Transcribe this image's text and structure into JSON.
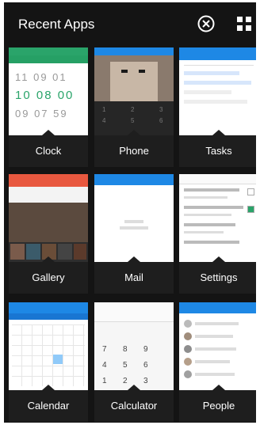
{
  "header": {
    "title": "Recent Apps"
  },
  "icons": {
    "close": "close-circle-icon",
    "grid": "grid-view-icon"
  },
  "apps": [
    {
      "label": "Clock"
    },
    {
      "label": "Phone"
    },
    {
      "label": "Tasks"
    },
    {
      "label": "Gallery"
    },
    {
      "label": "Mail"
    },
    {
      "label": "Settings"
    },
    {
      "label": "Calendar"
    },
    {
      "label": "Calculator"
    },
    {
      "label": "People"
    }
  ],
  "clock": {
    "times": [
      "11 09 01",
      "10 08 00",
      "09 07 59"
    ]
  },
  "calculator": {
    "keys": [
      "7",
      "8",
      "9",
      "4",
      "5",
      "6",
      "1",
      "2",
      "3"
    ]
  },
  "colors": {
    "green": "#2aa46a",
    "blue": "#1e88e5",
    "orange": "#e8583f",
    "dark": "#1e1e1e"
  }
}
